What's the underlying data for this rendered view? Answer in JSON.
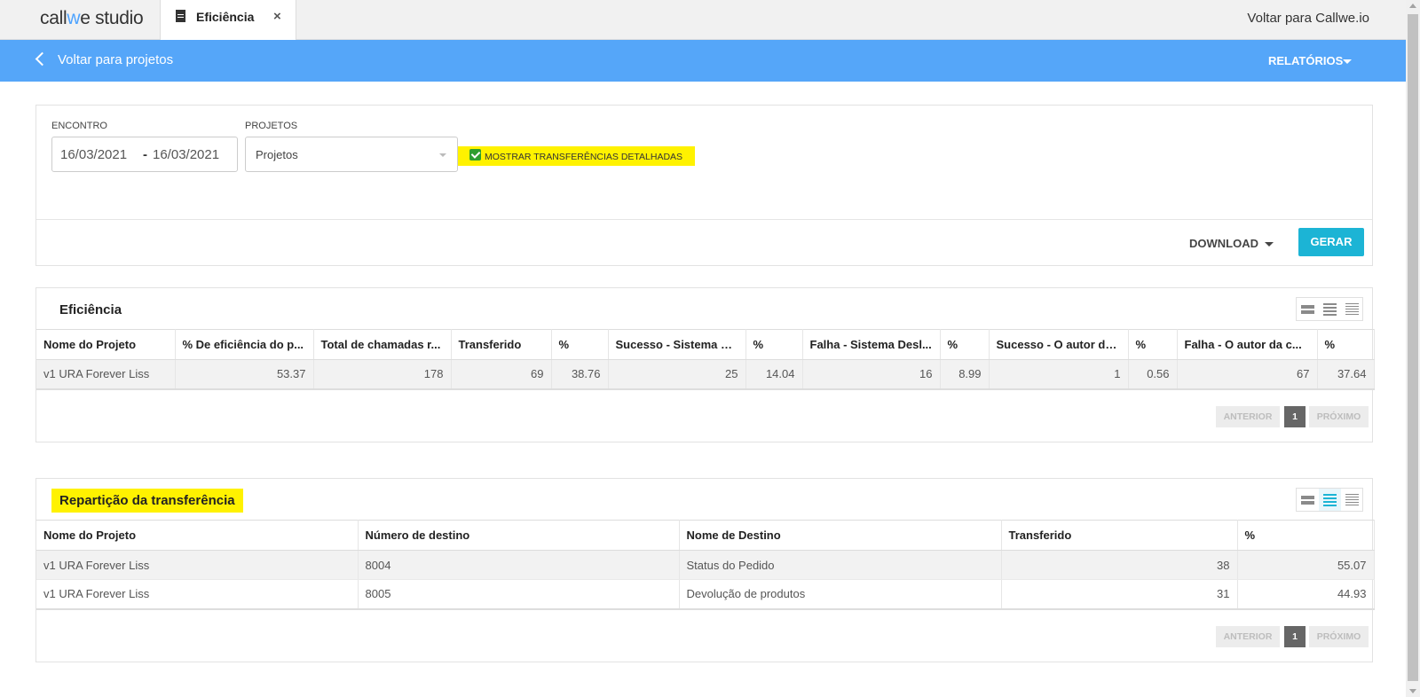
{
  "app": {
    "logo_prefix": "call",
    "logo_w": "w",
    "logo_suffix": "e studio",
    "tab_label": "Eficiência",
    "tab_close": "×",
    "back_site": "Voltar para Callwe.io"
  },
  "nav": {
    "back_label": "Voltar para projetos",
    "reports_label": "RELATÓRIOS"
  },
  "filters": {
    "encontro_label": "ENCONTRO",
    "date_from": "16/03/2021",
    "date_sep": "-",
    "date_to": "16/03/2021",
    "projetos_label": "PROJETOS",
    "projetos_value": "Projetos",
    "checkbox_label": "MOSTRAR TRANSFERÊNCIAS DETALHADAS",
    "checkbox_checked": true,
    "download_label": "DOWNLOAD",
    "gerar_label": "GERAR"
  },
  "eficiencia": {
    "title": "Eficiência",
    "columns": [
      "Nome do Projeto",
      "% De eficiência do p...",
      "Total de chamadas r...",
      "Transferido",
      "%",
      "Sucesso - Sistema D...",
      "%",
      "Falha - Sistema Desl...",
      "%",
      "Sucesso - O autor da...",
      "%",
      "Falha - O autor da c...",
      "%"
    ],
    "rows": [
      [
        "v1 URA Forever Liss",
        "53.37",
        "178",
        "69",
        "38.76",
        "25",
        "14.04",
        "16",
        "8.99",
        "1",
        "0.56",
        "67",
        "37.64"
      ]
    ],
    "pager": {
      "prev": "ANTERIOR",
      "page": "1",
      "next": "PRÓXIMO"
    }
  },
  "reparticao": {
    "title": "Repartição da transferência",
    "columns": [
      "Nome do Projeto",
      "Número de destino",
      "Nome de Destino",
      "Transferido",
      "%"
    ],
    "rows": [
      [
        "v1 URA Forever Liss",
        "8004",
        "Status do Pedido",
        "38",
        "55.07"
      ],
      [
        "v1 URA Forever Liss",
        "8005",
        "Devolução de produtos",
        "31",
        "44.93"
      ]
    ],
    "pager": {
      "prev": "ANTERIOR",
      "page": "1",
      "next": "PRÓXIMO"
    }
  },
  "colors": {
    "accent_blue": "#55a6f9",
    "button_teal": "#1cb4d5",
    "highlight_yellow": "#fff200"
  }
}
